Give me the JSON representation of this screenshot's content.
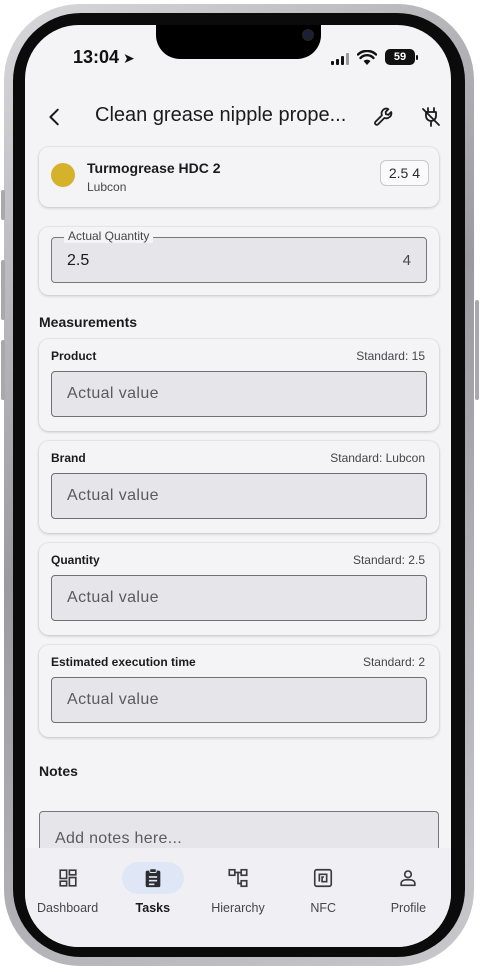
{
  "status_bar": {
    "time": "13:04",
    "battery": "59"
  },
  "app_bar": {
    "title": "Clean grease nipple prope...",
    "icons": [
      "back-arrow-icon",
      "wrench-icon",
      "unplug-icon"
    ]
  },
  "product": {
    "name": "Turmogrease HDC 2",
    "brand": "Lubcon",
    "chip": "2.5 4",
    "dot_color": "#d4b22c"
  },
  "actual_quantity": {
    "label": "Actual Quantity",
    "value": "2.5",
    "suffix": "4"
  },
  "measurements": {
    "title": "Measurements",
    "items": [
      {
        "label": "Product",
        "standard": "Standard: 15",
        "placeholder": "Actual value"
      },
      {
        "label": "Brand",
        "standard": "Standard: Lubcon",
        "placeholder": "Actual value"
      },
      {
        "label": "Quantity",
        "standard": "Standard: 2.5",
        "placeholder": "Actual value"
      },
      {
        "label": "Estimated execution time",
        "standard": "Standard: 2",
        "placeholder": "Actual value"
      }
    ]
  },
  "notes": {
    "title": "Notes",
    "placeholder": "Add notes here..."
  },
  "bottom_nav": {
    "items": [
      {
        "label": "Dashboard",
        "icon": "dashboard-icon"
      },
      {
        "label": "Tasks",
        "icon": "clipboard-icon",
        "active": true
      },
      {
        "label": "Hierarchy",
        "icon": "hierarchy-icon"
      },
      {
        "label": "NFC",
        "icon": "nfc-icon"
      },
      {
        "label": "Profile",
        "icon": "person-icon"
      }
    ]
  },
  "colors": {
    "accent_pill": "#dfe7f6",
    "product_dot": "#d4b22c",
    "background": "#f4f4f7"
  }
}
